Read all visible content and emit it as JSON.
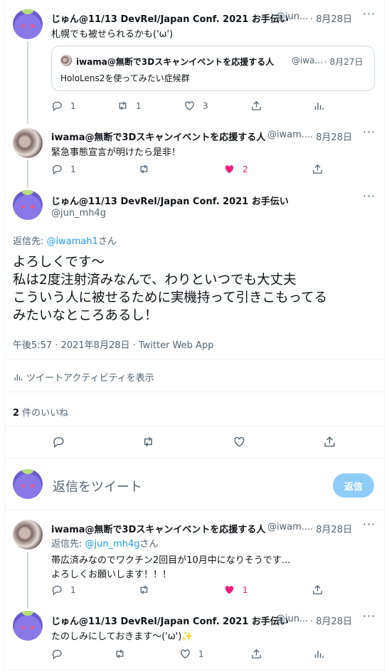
{
  "tweet1": {
    "name": "じゅん@11/13 DevRel/Japan Conf. 2021 お手伝い",
    "handle": "@jun...",
    "time": "· 8月28日",
    "text": "札幌でも被せられるかも('ω')",
    "quote": {
      "name": "iwama@無断で3Dスキャンイベントを応援する人",
      "handle": "@iwa...",
      "time": "· 8月27日",
      "text": "HoloLens2を使ってみたい症候群"
    },
    "replies": "1",
    "retweets": "1",
    "likes": "3"
  },
  "tweet2": {
    "name": "iwama@無断で3Dスキャンイベントを応援する人",
    "handle": "@iwam...",
    "time": "· 8月28日",
    "text": "緊急事態宣言が明けたら是非！",
    "replies": "1",
    "likes": "2"
  },
  "main": {
    "name": "じゅん@11/13 DevRel/Japan Conf. 2021 お手伝い",
    "handle": "@jun_mh4g",
    "reply_to_label": "返信先: ",
    "reply_to_handle": "@iwamah1",
    "reply_to_suffix": "さん",
    "lines": [
      "よろしくです〜",
      "私は2度注射済みなんで、わりといつでも大丈夫",
      "こういう人に被せるために実機持って引きこもってる",
      "みたいなところあるし！"
    ],
    "meta": "午後5:57 · 2021年8月28日 · Twitter Web App",
    "activity": "ツイートアクティビティを表示",
    "likes_count": "2",
    "likes_label": " 件のいいね"
  },
  "compose": {
    "placeholder": "返信をツイート",
    "button": "返信"
  },
  "tweet3": {
    "name": "iwama@無断で3Dスキャンイベントを応援する人",
    "handle": "@iwam...",
    "time": "· 8月28日",
    "reply_to_label": "返信先: ",
    "reply_to_handle": "@jun_mh4g",
    "reply_to_suffix": "さん",
    "line1": "帯広済みなのでワクチン2回目が10月中になりそうです...",
    "line2": "よろしくお願いします！！！",
    "replies": "1",
    "likes": "1"
  },
  "tweet4": {
    "name": "じゅん@11/13 DevRel/Japan Conf. 2021 お手伝い",
    "handle": "@jun...",
    "time": "· 8月28日",
    "text": "たのしみにしておきます〜('ω')",
    "sparkle": "✨",
    "likes": "1"
  },
  "colors": {
    "accent": "#1d9bf0",
    "like": "#f91880",
    "muted": "#536471",
    "button_disabled": "#8ecdf8"
  }
}
